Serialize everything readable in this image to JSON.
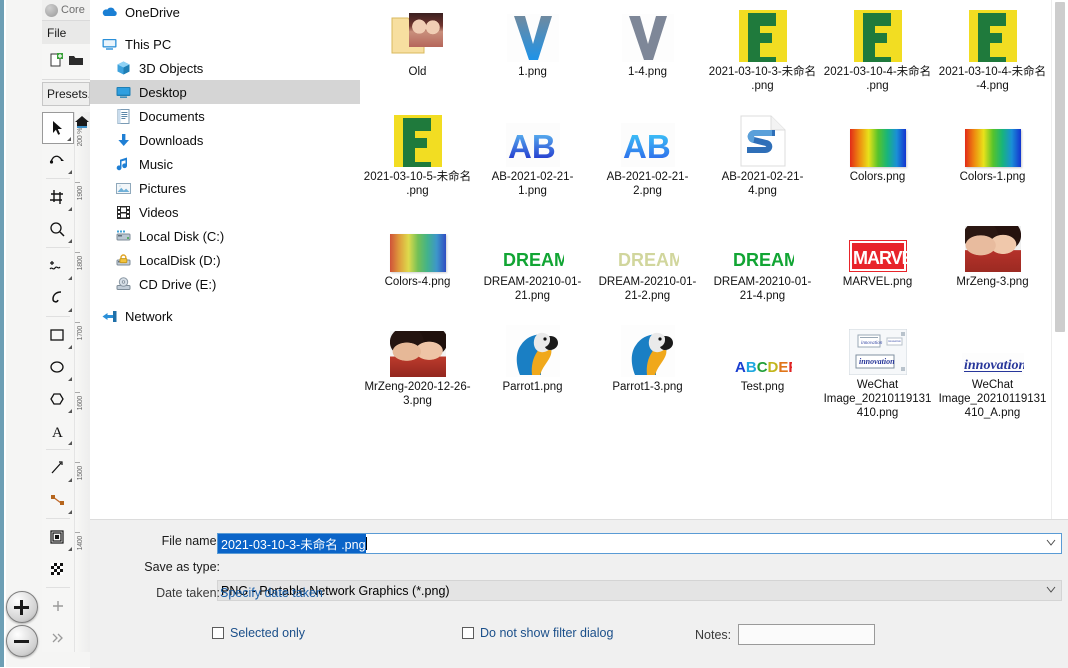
{
  "background_app": {
    "title": "Core",
    "menu": [
      "File"
    ],
    "presets_label": "Presets.",
    "ruler_unit": "200 %",
    "ruler_labels": [
      "1900",
      "1800",
      "1700",
      "1600",
      "1500",
      "1400"
    ],
    "tools": [
      {
        "name": "pick-tool",
        "glyph": "arrow"
      },
      {
        "name": "shape-tool",
        "glyph": "node"
      },
      {
        "name": "crop-tool",
        "glyph": "crop"
      },
      {
        "name": "zoom-tool",
        "glyph": "magnifier"
      },
      {
        "name": "freehand-tool",
        "glyph": "freehand"
      },
      {
        "name": "artistic-media-tool",
        "glyph": "curve"
      },
      {
        "name": "rectangle-tool",
        "glyph": "rect"
      },
      {
        "name": "ellipse-tool",
        "glyph": "ellipse"
      },
      {
        "name": "polygon-tool",
        "glyph": "polygon"
      },
      {
        "name": "text-tool",
        "glyph": "A"
      },
      {
        "name": "dimension-tool",
        "glyph": "dimension"
      },
      {
        "name": "connector-tool",
        "glyph": "connector"
      },
      {
        "name": "blend-tool",
        "glyph": "blend"
      },
      {
        "name": "transparency-tool",
        "glyph": "checker"
      },
      {
        "name": "add-tool",
        "glyph": "plus"
      },
      {
        "name": "more-tools",
        "glyph": "chevrons"
      }
    ],
    "zoom_in_label": "+",
    "zoom_out_label": "−"
  },
  "dialog": {
    "nav": {
      "items": [
        {
          "label": "OneDrive",
          "icon": "onedrive-cloud-icon",
          "level": 1,
          "selected": false
        },
        {
          "label": "This PC",
          "icon": "this-pc-monitor-icon",
          "level": 1,
          "selected": false
        },
        {
          "label": "3D Objects",
          "icon": "3d-objects-cube-icon",
          "level": 2,
          "selected": false
        },
        {
          "label": "Desktop",
          "icon": "desktop-monitor-icon",
          "level": 2,
          "selected": true
        },
        {
          "label": "Documents",
          "icon": "documents-icon",
          "level": 2,
          "selected": false
        },
        {
          "label": "Downloads",
          "icon": "downloads-arrow-icon",
          "level": 2,
          "selected": false
        },
        {
          "label": "Music",
          "icon": "music-note-icon",
          "level": 2,
          "selected": false
        },
        {
          "label": "Pictures",
          "icon": "pictures-icon",
          "level": 2,
          "selected": false
        },
        {
          "label": "Videos",
          "icon": "videos-film-icon",
          "level": 2,
          "selected": false
        },
        {
          "label": "Local Disk (C:)",
          "icon": "disk-drive-icon",
          "level": 2,
          "selected": false
        },
        {
          "label": "LocalDisk (D:)",
          "icon": "locked-disk-icon",
          "level": 2,
          "selected": false
        },
        {
          "label": "CD Drive (E:)",
          "icon": "cd-drive-icon",
          "level": 2,
          "selected": false
        },
        {
          "label": "Network",
          "icon": "network-icon",
          "level": 1,
          "selected": false
        }
      ]
    },
    "files": [
      {
        "name": "Old",
        "thumb": "folder-photo"
      },
      {
        "name": "1.png",
        "thumb": "letter-v-blue"
      },
      {
        "name": "1-4.png",
        "thumb": "letter-v-grey"
      },
      {
        "name": "2021-03-10-3-未命名 .png",
        "thumb": "green-e-yellow"
      },
      {
        "name": "2021-03-10-4-未命名 .png",
        "thumb": "green-e-yellow"
      },
      {
        "name": "2021-03-10-4-未命名 -4.png",
        "thumb": "green-e-yellow"
      },
      {
        "name": "2021-03-10-5-未命名 .png",
        "thumb": "green-e-yellow"
      },
      {
        "name": "AB-2021-02-21-1.png",
        "thumb": "ab-blue"
      },
      {
        "name": "AB-2021-02-21-2.png",
        "thumb": "ab-cyan"
      },
      {
        "name": "AB-2021-02-21-4.png",
        "thumb": "snip-s"
      },
      {
        "name": "Colors.png",
        "thumb": "rainbow"
      },
      {
        "name": "Colors-1.png",
        "thumb": "rainbow"
      },
      {
        "name": "Colors-4.png",
        "thumb": "rainbow-noise"
      },
      {
        "name": "DREAM-20210-01-21.png",
        "thumb": "dream-green"
      },
      {
        "name": "DREAM-20210-01-21-2.png",
        "thumb": "dream-faded"
      },
      {
        "name": "DREAM-20210-01-21-4.png",
        "thumb": "dream-green"
      },
      {
        "name": "MARVEL.png",
        "thumb": "marvel"
      },
      {
        "name": "MrZeng-3.png",
        "thumb": "couple-photo"
      },
      {
        "name": "MrZeng-2020-12-26-3.png",
        "thumb": "couple-photo2"
      },
      {
        "name": "Parrot1.png",
        "thumb": "parrot"
      },
      {
        "name": "Parrot1-3.png",
        "thumb": "parrot"
      },
      {
        "name": "Test.png",
        "thumb": "abcdef"
      },
      {
        "name": "WeChat Image_20210119131410.png",
        "thumb": "wechat-doc"
      },
      {
        "name": "WeChat Image_20210119131410_A.png",
        "thumb": "innovation"
      }
    ],
    "form": {
      "file_name_label": "File name:",
      "file_name_value": "2021-03-10-3-未命名 .png",
      "save_as_type_label": "Save as type:",
      "save_as_type_value": "PNG - Portable Network Graphics (*.png)",
      "date_taken_label": "Date taken:",
      "date_taken_link": "Specify date taken",
      "selected_only_label": "Selected only",
      "selected_only_checked": false,
      "no_filter_dialog_label": "Do not show filter dialog",
      "no_filter_dialog_checked": false,
      "notes_label": "Notes:",
      "notes_value": ""
    }
  },
  "colors": {
    "accent": "#0a64c8",
    "link": "#1b5fa8",
    "selection_row": "#d5d5d5",
    "footer_bg": "#f0f0f0"
  }
}
